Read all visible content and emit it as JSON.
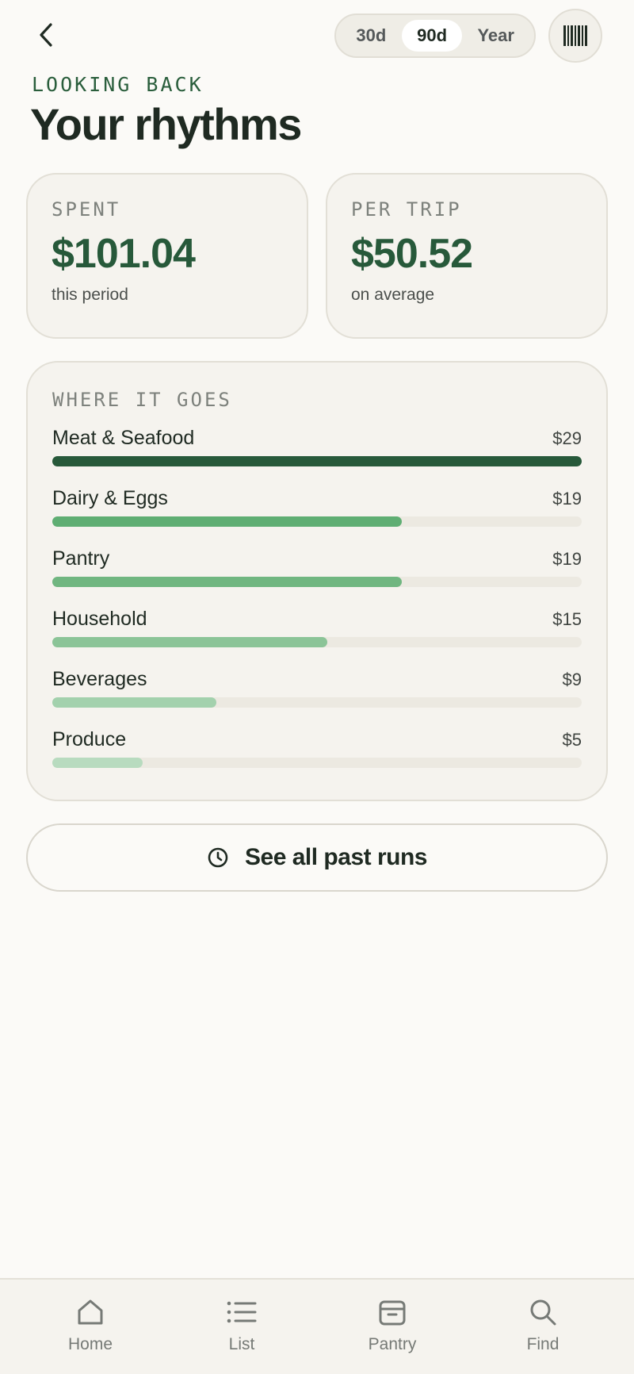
{
  "header": {
    "range_options": [
      "30d",
      "90d",
      "Year"
    ],
    "selected_range": "90d"
  },
  "page": {
    "eyebrow": "LOOKING BACK",
    "title": "Your rhythms"
  },
  "stats": [
    {
      "label": "SPENT",
      "value": "$101.04",
      "sub": "this period"
    },
    {
      "label": "PER TRIP",
      "value": "$50.52",
      "sub": "on average"
    }
  ],
  "breakdown": {
    "label": "WHERE IT GOES",
    "categories": [
      {
        "name": "Meat & Seafood",
        "amount": "$29",
        "share": 1.0,
        "color": "#27593a"
      },
      {
        "name": "Dairy & Eggs",
        "amount": "$19",
        "share": 0.66,
        "color": "#5fae73"
      },
      {
        "name": "Pantry",
        "amount": "$19",
        "share": 0.66,
        "color": "#70b680"
      },
      {
        "name": "Household",
        "amount": "$15",
        "share": 0.52,
        "color": "#8bc497"
      },
      {
        "name": "Beverages",
        "amount": "$9",
        "share": 0.31,
        "color": "#a3d1ad"
      },
      {
        "name": "Produce",
        "amount": "$5",
        "share": 0.17,
        "color": "#b8dbbf"
      }
    ]
  },
  "actions": {
    "past_runs_label": "See all past runs"
  },
  "nav": {
    "items": [
      {
        "label": "Home",
        "icon": "home-icon"
      },
      {
        "label": "List",
        "icon": "list-icon"
      },
      {
        "label": "Pantry",
        "icon": "pantry-icon"
      },
      {
        "label": "Find",
        "icon": "search-icon"
      }
    ]
  },
  "colors": {
    "accent": "#27593a",
    "background": "#fbfaf7",
    "card": "#f5f3ee"
  }
}
